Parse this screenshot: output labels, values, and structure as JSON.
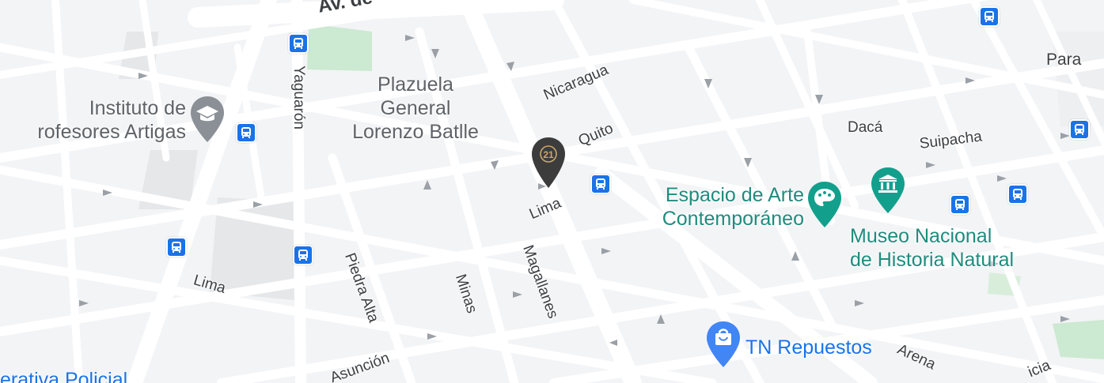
{
  "map": {
    "colors": {
      "background": "#f3f4f6",
      "road": "#ffffff",
      "block_gray": "#e6e7e9",
      "park": "#cce9d2",
      "transit": "#1a73e8",
      "museum": "#12a08c",
      "shop": "#4285f4",
      "label": "#3c4043"
    },
    "streets": [
      {
        "id": "av-de",
        "text": "Av. de"
      },
      {
        "id": "yaguaron",
        "text": "Yaguarón"
      },
      {
        "id": "nicaragua",
        "text": "Nicaragua"
      },
      {
        "id": "quito",
        "text": "Quito"
      },
      {
        "id": "lima-center",
        "text": "Lima"
      },
      {
        "id": "lima-left",
        "text": "Lima"
      },
      {
        "id": "piedra-alta",
        "text": "Piedra Alta"
      },
      {
        "id": "minas",
        "text": "Minas"
      },
      {
        "id": "magallanes",
        "text": "Magallanes"
      },
      {
        "id": "asuncion",
        "text": "Asunción"
      },
      {
        "id": "daca",
        "text": "Dacá"
      },
      {
        "id": "suipacha",
        "text": "Suipacha"
      },
      {
        "id": "para",
        "text": "Para"
      },
      {
        "id": "arena",
        "text": "Arena"
      },
      {
        "id": "icia",
        "text": "icia"
      }
    ],
    "places": {
      "instituto": {
        "line1": "Instituto de",
        "line2": "rofesores Artigas",
        "icon": "school-icon"
      },
      "plazuela": {
        "line1": "Plazuela",
        "line2": "General",
        "line3": "Lorenzo Batlle"
      },
      "espacio": {
        "line1": "Espacio de Arte",
        "line2": "Contemporáneo",
        "icon": "palette-icon"
      },
      "museo": {
        "line1": "Museo Nacional",
        "line2": "de Historia Natural",
        "icon": "museum-icon"
      },
      "tn_repuestos": {
        "text": "TN Repuestos",
        "icon": "shopping-bag-icon"
      },
      "policial": {
        "text": "erativa Policial"
      },
      "century21": {
        "text": "21",
        "icon": "century21-pin-icon"
      }
    }
  }
}
